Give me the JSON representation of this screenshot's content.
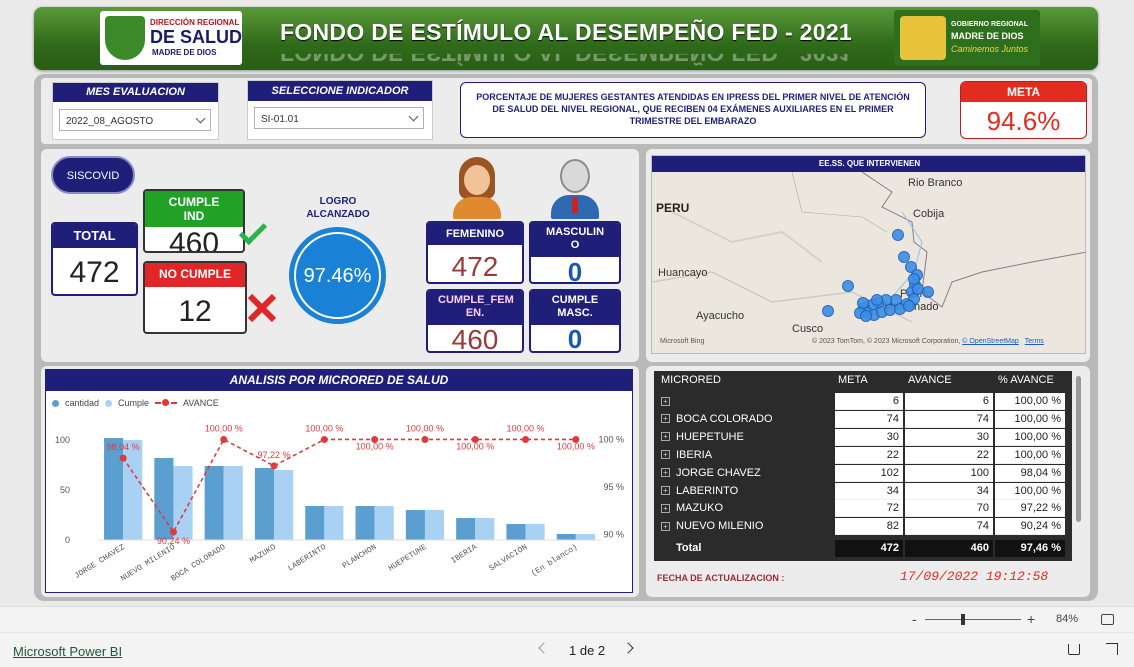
{
  "header": {
    "title": "FONDO DE ESTÍMULO AL DESEMPEÑO FED - 2021",
    "logo_left": {
      "line1": "DIRECCIÓN REGIONAL",
      "line2": "DE SALUD",
      "line3": "MADRE DE DIOS"
    },
    "logo_right": {
      "line1": "GOBIERNO REGIONAL",
      "line2": "MADRE DE DIOS",
      "line3": "Caminemos Juntos"
    }
  },
  "filters": {
    "mes_label": "MES EVALUACION",
    "mes_value": "2022_08_AGOSTO",
    "ind_label": "SELECCIONE INDICADOR",
    "ind_value": "SI-01.01"
  },
  "indicator_description": "PORCENTAJE DE MUJERES GESTANTES ATENDIDAS EN IPRESS DEL PRIMER NIVEL DE ATENCIÓN DE SALUD DEL NIVEL REGIONAL, QUE RECIBEN 04 EXÁMENES AUXILIARES EN EL PRIMER TRIMESTRE DEL EMBARAZO",
  "meta": {
    "label": "META",
    "value": "94.6%"
  },
  "kpis": {
    "siscovid": "SISCOVID",
    "total_label": "TOTAL",
    "total_value": "472",
    "cumple_label": "CUMPLE IND",
    "cumple_value": "460",
    "nocumple_label": "NO CUMPLE",
    "nocumple_value": "12",
    "logro_label": "LOGRO ALCANZADO",
    "logro_value": "97.46%",
    "logro_fraction": 0.9746,
    "femenino_label": "FEMENINO",
    "femenino_value": "472",
    "masculino_label": "MASCULIN O",
    "masculino_value": "0",
    "cumple_fem_label": "CUMPLE_FEM EN.",
    "cumple_fem_value": "460",
    "cumple_masc_label": "CUMPLE MASC.",
    "cumple_masc_value": "0"
  },
  "map": {
    "title": "EE.SS. QUE INTERVIENEN",
    "labels": [
      "Rio Branco",
      "PERU",
      "Cobija",
      "Huancayo",
      "Puerto",
      "Maldonado",
      "Ayacucho",
      "Cusco"
    ],
    "attribution": "© 2023 TomTom, © 2023 Microsoft Corporation,",
    "osm": "© OpenStreetMap",
    "terms": "Terms",
    "bing": "Microsoft Bing"
  },
  "chart_data": {
    "type": "bar",
    "title": "ANALISIS POR MICRORED DE SALUD",
    "legend": [
      "cantidad",
      "Cumple",
      "AVANCE"
    ],
    "categories": [
      "JORGE CHAVEZ",
      "NUEVO MILENIO",
      "BOCA COLORADO",
      "MAZUKO",
      "LABERINTO",
      "PLANCHON",
      "HUEPETUHE",
      "IBERIA",
      "SALVACION",
      "(En blanco)"
    ],
    "series": [
      {
        "name": "cantidad",
        "values": [
          102,
          82,
          74,
          72,
          34,
          34,
          30,
          22,
          16,
          6
        ],
        "color": "#5a9fd0"
      },
      {
        "name": "Cumple",
        "values": [
          100,
          74,
          74,
          70,
          34,
          34,
          30,
          22,
          16,
          6
        ],
        "color": "#a9d1f3"
      },
      {
        "name": "AVANCE",
        "values": [
          98.04,
          90.24,
          100,
          97.22,
          100,
          100,
          100,
          100,
          100,
          100
        ],
        "color": "#e0393b"
      }
    ],
    "avance_labels": [
      "98,04 %",
      "90,24 %",
      "100,00 %",
      "97,22 %",
      "100,00 %",
      "100,00 %",
      "100,00 %",
      "100,00 %",
      "100,00 %",
      "100,00 %"
    ],
    "ylim": [
      0,
      110
    ],
    "yticks": [
      "0",
      "50",
      "100"
    ],
    "y2lim": [
      89.4,
      101
    ],
    "y2ticks": [
      "90 %",
      "95 %",
      "100 %"
    ]
  },
  "table": {
    "headers": [
      "MICRORED",
      "META",
      "AVANCE",
      "% AVANCE"
    ],
    "rows": [
      [
        "",
        "6",
        "6",
        "100,00 %"
      ],
      [
        "BOCA COLORADO",
        "74",
        "74",
        "100,00 %"
      ],
      [
        "HUEPETUHE",
        "30",
        "30",
        "100,00 %"
      ],
      [
        "IBERIA",
        "22",
        "22",
        "100,00 %"
      ],
      [
        "JORGE CHAVEZ",
        "102",
        "100",
        "98,04 %"
      ],
      [
        "LABERINTO",
        "34",
        "34",
        "100,00 %"
      ],
      [
        "MAZUKO",
        "72",
        "70",
        "97,22 %"
      ],
      [
        "NUEVO MILENIO",
        "82",
        "74",
        "90,24 %"
      ]
    ],
    "total": [
      "Total",
      "472",
      "460",
      "97,46 %"
    ]
  },
  "update": {
    "label": "FECHA DE ACTUALIZACION :",
    "value": "17/09/2022 19:12:58"
  },
  "footer": {
    "brand": "Microsoft Power BI",
    "page": "1 de 2",
    "zoom": "84%"
  }
}
